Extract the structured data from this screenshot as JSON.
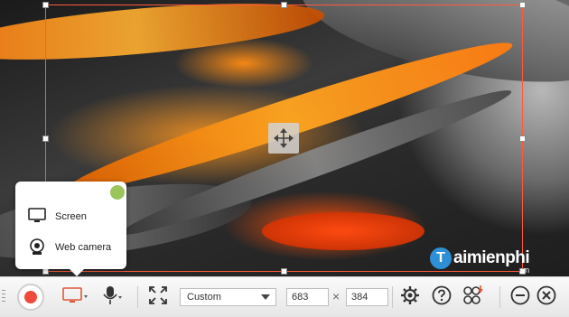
{
  "popup": {
    "items": [
      {
        "label": "Screen",
        "icon": "monitor-icon"
      },
      {
        "label": "Web camera",
        "icon": "webcam-icon"
      }
    ]
  },
  "toolbar": {
    "preset": "Custom",
    "width": "683",
    "height": "384",
    "times_symbol": "×"
  },
  "watermark": {
    "letter": "T",
    "name": "aimienphi",
    "suffix": ".vn"
  },
  "colors": {
    "record": "#f04a3a",
    "selection_border": "#ff5a3a",
    "accent_orange": "#ff8a1a",
    "watermark_blue": "#2d8fd5"
  }
}
